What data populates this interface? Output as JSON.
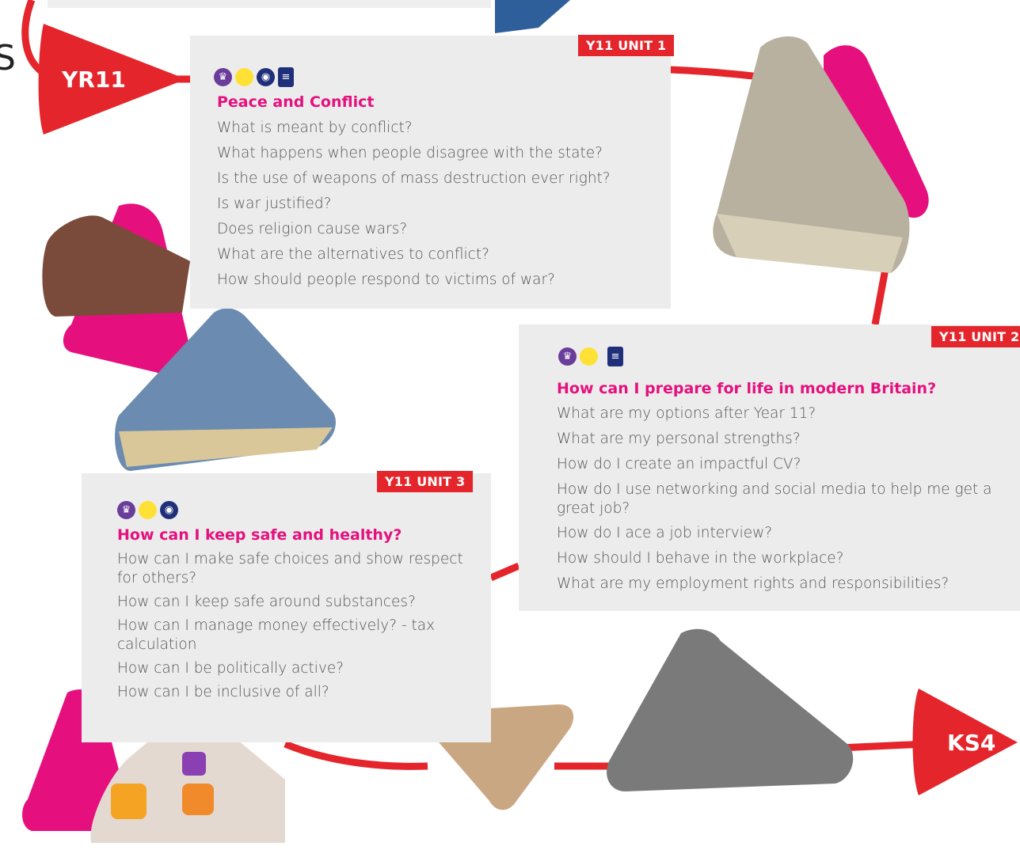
{
  "start_marker": {
    "label": "YR11",
    "partial_letter": "S"
  },
  "end_marker": {
    "label": "KS4"
  },
  "units": [
    {
      "tag": "Y11 UNIT 1",
      "title": "Peace and Conflict",
      "icons": [
        "citizenship-icon",
        "yellow-dot-icon",
        "globe-icon",
        "document-icon"
      ],
      "questions": [
        "What is meant by conflict?",
        "What happens when people disagree with the state?",
        "Is the use of weapons of mass destruction ever right?",
        "Is war justified?",
        "Does religion cause wars?",
        "What are the alternatives to conflict?",
        "How should people respond to victims of war?"
      ]
    },
    {
      "tag": "Y11 UNIT 2",
      "title": "How can I prepare for life in modern Britain?",
      "icons": [
        "citizenship-icon",
        "yellow-dot-icon",
        "document-icon"
      ],
      "questions": [
        "What are my options after Year 11?",
        "What are my personal strengths?",
        "How do I create an impactful CV?",
        "How do I use networking and social media to help me get a great job?",
        "How do I ace a job interview?",
        "How should I behave in the workplace?",
        "What are my employment rights and responsibilities?"
      ]
    },
    {
      "tag": "Y11 UNIT 3",
      "title": "How can I keep safe and healthy?",
      "icons": [
        "citizenship-icon",
        "yellow-dot-icon",
        "globe-icon"
      ],
      "questions": [
        "How can I make safe choices and show respect for others?",
        "How can I keep safe around substances?",
        "How can I manage money effectively? - tax calculation",
        "How can I be politically active?",
        "How can I be inclusive of all?"
      ]
    }
  ],
  "colors": {
    "accent_red": "#e4262c",
    "accent_pink": "#e5107e",
    "card_bg": "#ececec",
    "icon_navy": "#1f2f7a",
    "icon_purple": "#6a3d9a",
    "icon_yellow": "#ffe135"
  }
}
